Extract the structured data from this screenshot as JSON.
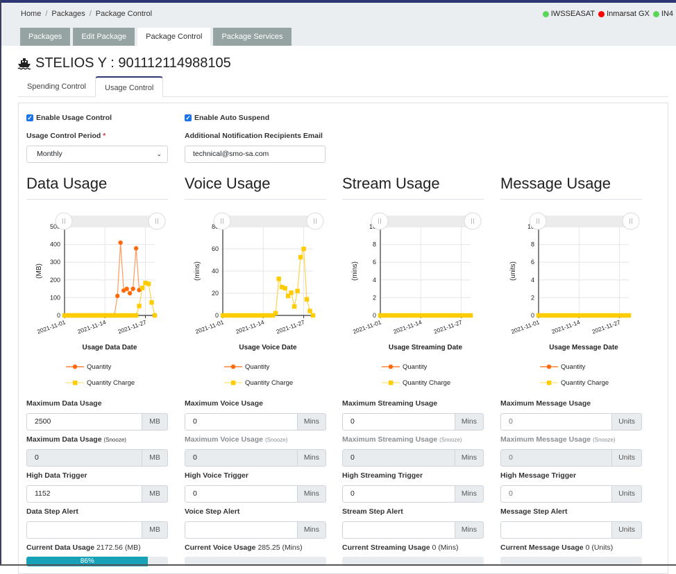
{
  "breadcrumb": [
    "Home",
    "Packages",
    "Package Control"
  ],
  "status_indicators": [
    {
      "label": "IWSSEASAT",
      "color": "#5ad55a"
    },
    {
      "label": "Inmarsat GX",
      "color": "#ff0000"
    },
    {
      "label": "IN4",
      "color": "#5ad55a"
    }
  ],
  "main_tabs": [
    {
      "label": "Packages",
      "active": false
    },
    {
      "label": "Edit Package",
      "active": false
    },
    {
      "label": "Package Control",
      "active": true
    },
    {
      "label": "Package Services",
      "active": false
    }
  ],
  "title": {
    "icon": "ship-icon",
    "text": "STELIOS Y : 901112114988105"
  },
  "sub_tabs": [
    {
      "label": "Spending Control",
      "active": false
    },
    {
      "label": "Usage Control",
      "active": true
    }
  ],
  "form": {
    "enable_usage_control": {
      "label": "Enable Usage Control",
      "checked": true
    },
    "enable_auto_suspend": {
      "label": "Enable Auto Suspend",
      "checked": true
    },
    "period_label": "Usage Control Period",
    "period_required": "*",
    "period_value": "Monthly",
    "email_label": "Additional Notification Recipients Email",
    "email_value": "technical@smo-sa.com"
  },
  "legend": {
    "quantity": "Quantity",
    "charge": "Quantity Charge"
  },
  "colors": {
    "quantity": "#ff6a0d",
    "charge": "#ffcc00",
    "progress": "#17a2b8"
  },
  "sections": [
    {
      "heading": "Data Usage",
      "max_label": "Maximum Data Usage",
      "max_value": "2500",
      "unit": "MB",
      "snooze_label": "Maximum Data Usage",
      "snooze_suffix": "(Snooze)",
      "snooze_value": "0",
      "trigger_label": "High Data Trigger",
      "trigger_value": "1152",
      "step_label": "Data Step Alert",
      "step_value": "",
      "current_label": "Current Data Usage",
      "current_value": "2172.56",
      "current_unit": "(MB)",
      "progress_percent": 86,
      "progress_text": "86%"
    },
    {
      "heading": "Voice Usage",
      "max_label": "Maximum Voice Usage",
      "max_value": "0",
      "unit": "Mins",
      "snooze_label": "Maximum Voice Usage",
      "snooze_suffix": "(Snooze)",
      "snooze_value": "0",
      "trigger_label": "High Voice Trigger",
      "trigger_value": "0",
      "step_label": "Voice Step Alert",
      "step_value": "",
      "current_label": "Current Voice Usage",
      "current_value": "285.25",
      "current_unit": "(Mins)",
      "progress_percent": 0,
      "progress_text": ""
    },
    {
      "heading": "Stream Usage",
      "max_label": "Maximum Streaming Usage",
      "max_value": "0",
      "unit": "Mins",
      "snooze_label": "Maximum Streaming Usage",
      "snooze_suffix": "(Snooze)",
      "snooze_value": "0",
      "trigger_label": "High Streaming Trigger",
      "trigger_value": "0",
      "step_label": "Stream Step Alert",
      "step_value": "",
      "current_label": "Current Streaming Usage",
      "current_value": "0",
      "current_unit": "(Mins)",
      "progress_percent": 0,
      "progress_text": ""
    },
    {
      "heading": "Message Usage",
      "max_label": "Maximum Message Usage",
      "max_value": "0",
      "unit": "Units",
      "snooze_label": "Maximum Message Usage",
      "snooze_suffix": "(Snooze)",
      "snooze_value": "0",
      "trigger_label": "High Message Trigger",
      "trigger_value": "0",
      "step_label": "Message Step Alert",
      "step_value": "",
      "current_label": "Current Message Usage",
      "current_value": "0",
      "current_unit": "(Units)",
      "progress_percent": 0,
      "progress_text": ""
    }
  ],
  "chart_data": [
    {
      "type": "line",
      "title": "Data Usage",
      "xlabel": "Usage Data Date",
      "ylabel": "(MB)",
      "ylim": [
        0,
        500
      ],
      "yticks": [
        0,
        100,
        200,
        300,
        400,
        500
      ],
      "xticks": [
        "2021-11-01",
        "2021-11-14",
        "2021-11-27"
      ],
      "x": [
        "2021-11-01",
        "2021-11-02",
        "2021-11-03",
        "2021-11-04",
        "2021-11-05",
        "2021-11-06",
        "2021-11-07",
        "2021-11-08",
        "2021-11-09",
        "2021-11-10",
        "2021-11-11",
        "2021-11-12",
        "2021-11-13",
        "2021-11-14",
        "2021-11-15",
        "2021-11-16",
        "2021-11-17",
        "2021-11-18",
        "2021-11-19",
        "2021-11-20",
        "2021-11-21",
        "2021-11-22",
        "2021-11-23",
        "2021-11-24",
        "2021-11-25",
        "2021-11-26",
        "2021-11-27",
        "2021-11-28",
        "2021-11-29",
        "2021-11-30"
      ],
      "series": [
        {
          "name": "Quantity",
          "values": [
            0,
            0,
            0,
            0,
            0,
            0,
            0,
            0,
            0,
            0,
            0,
            0,
            0,
            0,
            0,
            0,
            0,
            110,
            410,
            140,
            150,
            125,
            150,
            378,
            143,
            null,
            null,
            null,
            null,
            null
          ]
        },
        {
          "name": "Quantity Charge",
          "values": [
            0,
            0,
            0,
            0,
            0,
            0,
            0,
            0,
            0,
            0,
            0,
            0,
            0,
            0,
            0,
            0,
            0,
            0,
            0,
            0,
            0,
            0,
            0,
            0,
            53,
            155,
            183,
            178,
            73,
            0
          ]
        }
      ],
      "legend": "bottom"
    },
    {
      "type": "line",
      "title": "Voice Usage",
      "xlabel": "Usage Voice Date",
      "ylabel": "(mins)",
      "ylim": [
        0,
        80
      ],
      "yticks": [
        0,
        20,
        40,
        60,
        80
      ],
      "xticks": [
        "2021-11-01",
        "2021-11-14",
        "2021-11-27"
      ],
      "x": [
        "2021-11-01",
        "2021-11-02",
        "2021-11-03",
        "2021-11-04",
        "2021-11-05",
        "2021-11-06",
        "2021-11-07",
        "2021-11-08",
        "2021-11-09",
        "2021-11-10",
        "2021-11-11",
        "2021-11-12",
        "2021-11-13",
        "2021-11-14",
        "2021-11-15",
        "2021-11-16",
        "2021-11-17",
        "2021-11-18",
        "2021-11-19",
        "2021-11-20",
        "2021-11-21",
        "2021-11-22",
        "2021-11-23",
        "2021-11-24",
        "2021-11-25",
        "2021-11-26",
        "2021-11-27",
        "2021-11-28",
        "2021-11-29",
        "2021-11-30"
      ],
      "series": [
        {
          "name": "Quantity",
          "values": []
        },
        {
          "name": "Quantity Charge",
          "values": [
            0,
            0,
            0,
            0,
            0,
            0,
            0,
            0,
            0,
            0,
            0,
            0,
            0,
            0,
            0,
            0,
            0,
            2,
            33,
            25.5,
            24.5,
            17.5,
            20.5,
            8,
            22,
            52.5,
            60,
            14.5,
            4,
            0
          ]
        }
      ],
      "legend": "bottom"
    },
    {
      "type": "line",
      "title": "Stream Usage",
      "xlabel": "Usage Streaming Date",
      "ylabel": "(mins)",
      "ylim": [
        0,
        10
      ],
      "yticks": [
        0,
        2,
        4,
        6,
        8,
        10
      ],
      "xticks": [
        "2021-11-01",
        "2021-11-14",
        "2021-11-27"
      ],
      "x": [
        "2021-11-01",
        "2021-11-02",
        "2021-11-03",
        "2021-11-04",
        "2021-11-05",
        "2021-11-06",
        "2021-11-07",
        "2021-11-08",
        "2021-11-09",
        "2021-11-10",
        "2021-11-11",
        "2021-11-12",
        "2021-11-13",
        "2021-11-14",
        "2021-11-15",
        "2021-11-16",
        "2021-11-17",
        "2021-11-18",
        "2021-11-19",
        "2021-11-20",
        "2021-11-21",
        "2021-11-22",
        "2021-11-23",
        "2021-11-24",
        "2021-11-25",
        "2021-11-26",
        "2021-11-27",
        "2021-11-28",
        "2021-11-29",
        "2021-11-30"
      ],
      "series": [
        {
          "name": "Quantity",
          "values": []
        },
        {
          "name": "Quantity Charge",
          "values": [
            0,
            0,
            0,
            0,
            0,
            0,
            0,
            0,
            0,
            0,
            0,
            0,
            0,
            0,
            0,
            0,
            0,
            0,
            0,
            0,
            0,
            0,
            0,
            0,
            0,
            0,
            0,
            0,
            0,
            0
          ]
        }
      ],
      "legend": "bottom"
    },
    {
      "type": "line",
      "title": "Message Usage",
      "xlabel": "Usage Message Date",
      "ylabel": "(units)",
      "ylim": [
        0,
        10
      ],
      "yticks": [
        0,
        2,
        4,
        6,
        8,
        10
      ],
      "xticks": [
        "2021-11-01",
        "2021-11-14",
        "2021-11-27"
      ],
      "x": [
        "2021-11-01",
        "2021-11-02",
        "2021-11-03",
        "2021-11-04",
        "2021-11-05",
        "2021-11-06",
        "2021-11-07",
        "2021-11-08",
        "2021-11-09",
        "2021-11-10",
        "2021-11-11",
        "2021-11-12",
        "2021-11-13",
        "2021-11-14",
        "2021-11-15",
        "2021-11-16",
        "2021-11-17",
        "2021-11-18",
        "2021-11-19",
        "2021-11-20",
        "2021-11-21",
        "2021-11-22",
        "2021-11-23",
        "2021-11-24",
        "2021-11-25",
        "2021-11-26",
        "2021-11-27",
        "2021-11-28",
        "2021-11-29",
        "2021-11-30"
      ],
      "series": [
        {
          "name": "Quantity",
          "values": []
        },
        {
          "name": "Quantity Charge",
          "values": [
            0,
            0,
            0,
            0,
            0,
            0,
            0,
            0,
            0,
            0,
            0,
            0,
            0,
            0,
            0,
            0,
            0,
            0,
            0,
            0,
            0,
            0,
            0,
            0,
            0,
            0,
            0,
            0,
            0,
            0
          ]
        }
      ],
      "legend": "bottom"
    }
  ]
}
